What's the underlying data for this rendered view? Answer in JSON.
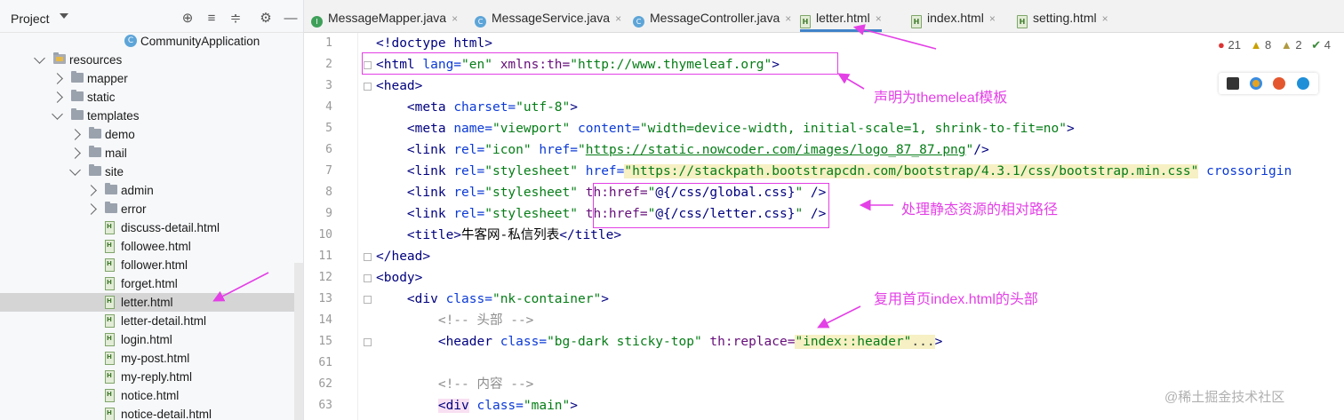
{
  "project": {
    "title": "Project",
    "tree": [
      {
        "label": "CommunityApplication",
        "icon": "app-class-icon",
        "indent": 140,
        "expander": "none"
      },
      {
        "label": "resources",
        "icon": "resources-folder-icon",
        "indent": 60,
        "expander": "down"
      },
      {
        "label": "mapper",
        "icon": "folder-icon",
        "indent": 80,
        "expander": "right"
      },
      {
        "label": "static",
        "icon": "folder-icon",
        "indent": 80,
        "expander": "right"
      },
      {
        "label": "templates",
        "icon": "folder-icon",
        "indent": 80,
        "expander": "down"
      },
      {
        "label": "demo",
        "icon": "folder-icon",
        "indent": 100,
        "expander": "right"
      },
      {
        "label": "mail",
        "icon": "folder-icon",
        "indent": 100,
        "expander": "right"
      },
      {
        "label": "site",
        "icon": "folder-icon",
        "indent": 100,
        "expander": "down"
      },
      {
        "label": "admin",
        "icon": "folder-icon",
        "indent": 118,
        "expander": "right"
      },
      {
        "label": "error",
        "icon": "folder-icon",
        "indent": 118,
        "expander": "right"
      },
      {
        "label": "discuss-detail.html",
        "icon": "html-file-icon",
        "indent": 118,
        "expander": "none"
      },
      {
        "label": "followee.html",
        "icon": "html-file-icon",
        "indent": 118,
        "expander": "none"
      },
      {
        "label": "follower.html",
        "icon": "html-file-icon",
        "indent": 118,
        "expander": "none"
      },
      {
        "label": "forget.html",
        "icon": "html-file-icon",
        "indent": 118,
        "expander": "none"
      },
      {
        "label": "letter.html",
        "icon": "html-file-icon",
        "indent": 118,
        "expander": "none",
        "selected": true
      },
      {
        "label": "letter-detail.html",
        "icon": "html-file-icon",
        "indent": 118,
        "expander": "none"
      },
      {
        "label": "login.html",
        "icon": "html-file-icon",
        "indent": 118,
        "expander": "none"
      },
      {
        "label": "my-post.html",
        "icon": "html-file-icon",
        "indent": 118,
        "expander": "none"
      },
      {
        "label": "my-reply.html",
        "icon": "html-file-icon",
        "indent": 118,
        "expander": "none"
      },
      {
        "label": "notice.html",
        "icon": "html-file-icon",
        "indent": 118,
        "expander": "none"
      },
      {
        "label": "notice-detail.html",
        "icon": "html-file-icon",
        "indent": 118,
        "expander": "none"
      }
    ]
  },
  "tabs": [
    {
      "label": "MessageMapper.java",
      "icon": "interface-icon",
      "active": false
    },
    {
      "label": "MessageService.java",
      "icon": "class-icon",
      "active": false
    },
    {
      "label": "MessageController.java",
      "icon": "class-icon",
      "active": false
    },
    {
      "label": "letter.html",
      "icon": "html-file-icon",
      "active": true
    },
    {
      "label": "index.html",
      "icon": "html-file-icon",
      "active": false
    },
    {
      "label": "setting.html",
      "icon": "html-file-icon",
      "active": false
    }
  ],
  "inspections": {
    "errors": "21",
    "warnings": "8",
    "weak_warnings": "2",
    "typos": "4"
  },
  "code_lines": [
    {
      "n": "1",
      "fold": false,
      "html": "<span class='kw'>&lt;!doctype</span> <span class='tg'>html</span><span class='kw'>&gt;</span>"
    },
    {
      "n": "2",
      "fold": true,
      "html": "<span class='tg'>&lt;html</span> <span class='at'>lang=</span><span class='st'>\"en\"</span> <span class='ns'>xmlns:th=</span><span class='st'>\"http://www.thymeleaf.org\"</span><span class='tg'>&gt;</span>"
    },
    {
      "n": "3",
      "fold": true,
      "html": "<span class='tg'>&lt;head&gt;</span>"
    },
    {
      "n": "4",
      "fold": false,
      "html": "    <span class='tg'>&lt;meta</span> <span class='at'>charset=</span><span class='st'>\"utf-8\"</span><span class='tg'>&gt;</span>"
    },
    {
      "n": "5",
      "fold": false,
      "html": "    <span class='tg'>&lt;meta</span> <span class='at'>name=</span><span class='st'>\"viewport\"</span> <span class='at'>content=</span><span class='st'>\"width=device-width, initial-scale=1, shrink-to-fit=no\"</span><span class='tg'>&gt;</span>"
    },
    {
      "n": "6",
      "fold": false,
      "html": "    <span class='tg'>&lt;link</span> <span class='at'>rel=</span><span class='st'>\"icon\"</span> <span class='at'>href=</span><span class='st'>\"<span class='url'>https://static.nowcoder.com/images/logo_87_87.png</span>\"</span><span class='tg'>/&gt;</span>"
    },
    {
      "n": "7",
      "fold": false,
      "html": "    <span class='tg'>&lt;link</span> <span class='at'>rel=</span><span class='st'>\"stylesheet\"</span> <span class='at'>href=</span><span class='st hl'>\"https://stackpath.bootstrapcdn.com/bootstrap/4.3.1/css/bootstrap.min.css\"</span> <span class='at'>crossorigin</span>"
    },
    {
      "n": "8",
      "fold": false,
      "html": "    <span class='tg'>&lt;link</span> <span class='at'>rel=</span><span class='st'>\"stylesheet\"</span> <span class='ns'>th:href=</span><span class='st'>\"<span class='tg'>@{/css/global.css}</span>\"</span> <span class='tg'>/&gt;</span>"
    },
    {
      "n": "9",
      "fold": false,
      "html": "    <span class='tg'>&lt;link</span> <span class='at'>rel=</span><span class='st'>\"stylesheet\"</span> <span class='ns'>th:href=</span><span class='st'>\"<span class='tg'>@{/css/letter.css}</span>\"</span> <span class='tg'>/&gt;</span>"
    },
    {
      "n": "10",
      "fold": false,
      "html": "    <span class='tg'>&lt;title&gt;</span>牛客网-私信列表<span class='tg'>&lt;/title&gt;</span>"
    },
    {
      "n": "11",
      "fold": true,
      "html": "<span class='tg'>&lt;/head&gt;</span>"
    },
    {
      "n": "12",
      "fold": true,
      "html": "<span class='tg'>&lt;body&gt;</span>"
    },
    {
      "n": "13",
      "fold": true,
      "html": "    <span class='tg'>&lt;div</span> <span class='at'>class=</span><span class='st'>\"nk-container\"</span><span class='tg'>&gt;</span>"
    },
    {
      "n": "14",
      "fold": false,
      "html": "        <span class='cm'>&lt;!-- 头部 --&gt;</span>"
    },
    {
      "n": "15",
      "fold": true,
      "html": "        <span class='tg'>&lt;header</span> <span class='at'>class=</span><span class='st'>\"bg-dark sticky-top\"</span> <span class='ns'>th:replace=</span><span class='st hl'>\"index::header\"</span><span class='fold-ph'>...</span><span class='tg'>&gt;</span>"
    },
    {
      "n": "61",
      "fold": false,
      "html": ""
    },
    {
      "n": "62",
      "fold": false,
      "html": "        <span class='cm'>&lt;!-- 内容 --&gt;</span>"
    },
    {
      "n": "63",
      "fold": false,
      "html": "        <span class='tg div-hl'>&lt;div</span> <span class='at'>class=</span><span class='st'>\"main\"</span><span class='tg'>&gt;</span>"
    }
  ],
  "annotations": {
    "thymeleaf": "声明为themeleaf模板",
    "static": "处理静态资源的相对路径",
    "header": "复用首页index.html的头部"
  },
  "watermark": "@稀土掘金技术社区",
  "colors": {
    "annotation": "#e340e6",
    "active_tab_underline": "#4083c9"
  }
}
